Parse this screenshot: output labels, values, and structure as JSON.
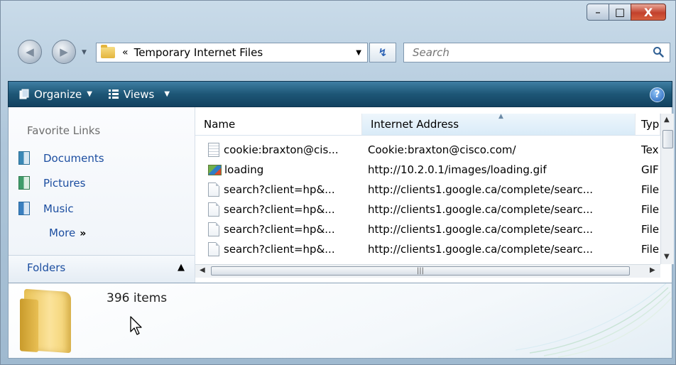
{
  "window": {
    "minimize_glyph": "–",
    "maximize_glyph": "□",
    "close_glyph": "X"
  },
  "address_bar": {
    "back_glyph": "◀",
    "forward_glyph": "▶",
    "breadcrumb_separator": "«",
    "current_folder": "Temporary Internet Files",
    "dropdown_glyph": "▼"
  },
  "refresh": {
    "glyph": "↯"
  },
  "search": {
    "placeholder": "Search",
    "icon": "search-icon"
  },
  "toolbar": {
    "organize_label": "Organize",
    "views_label": "Views",
    "help_glyph": "?"
  },
  "navigation": {
    "favorites_title": "Favorite Links",
    "items": [
      {
        "label": "Documents",
        "icon": "documents-icon"
      },
      {
        "label": "Pictures",
        "icon": "pictures-icon"
      },
      {
        "label": "Music",
        "icon": "music-icon"
      }
    ],
    "more_label": "More",
    "more_glyph": "»",
    "folders_label": "Folders"
  },
  "file_list": {
    "columns": [
      {
        "label": "Name"
      },
      {
        "label": "Internet Address",
        "sorted": true
      },
      {
        "label": "Typ"
      }
    ],
    "rows": [
      {
        "name": "cookie:braxton@cis...",
        "address": "Cookie:braxton@cisco.com/",
        "type": "Tex",
        "icon": "text-file-icon"
      },
      {
        "name": "loading",
        "address": "http://10.2.0.1/images/loading.gif",
        "type": "GIF",
        "icon": "image-file-icon"
      },
      {
        "name": "search?client=hp&...",
        "address": "http://clients1.google.ca/complete/searc...",
        "type": "File",
        "icon": "file-icon"
      },
      {
        "name": "search?client=hp&...",
        "address": "http://clients1.google.ca/complete/searc...",
        "type": "File",
        "icon": "file-icon"
      },
      {
        "name": "search?client=hp&...",
        "address": "http://clients1.google.ca/complete/searc...",
        "type": "File",
        "icon": "file-icon"
      },
      {
        "name": "search?client=hp&...",
        "address": "http://clients1.google.ca/complete/searc...",
        "type": "File",
        "icon": "file-icon"
      }
    ]
  },
  "details_pane": {
    "item_count": "396 items"
  },
  "colors": {
    "toolbar": "#1d5676",
    "link": "#1c4ea0",
    "sorted_header": "#d9ebf8",
    "close_button": "#c2412c"
  }
}
